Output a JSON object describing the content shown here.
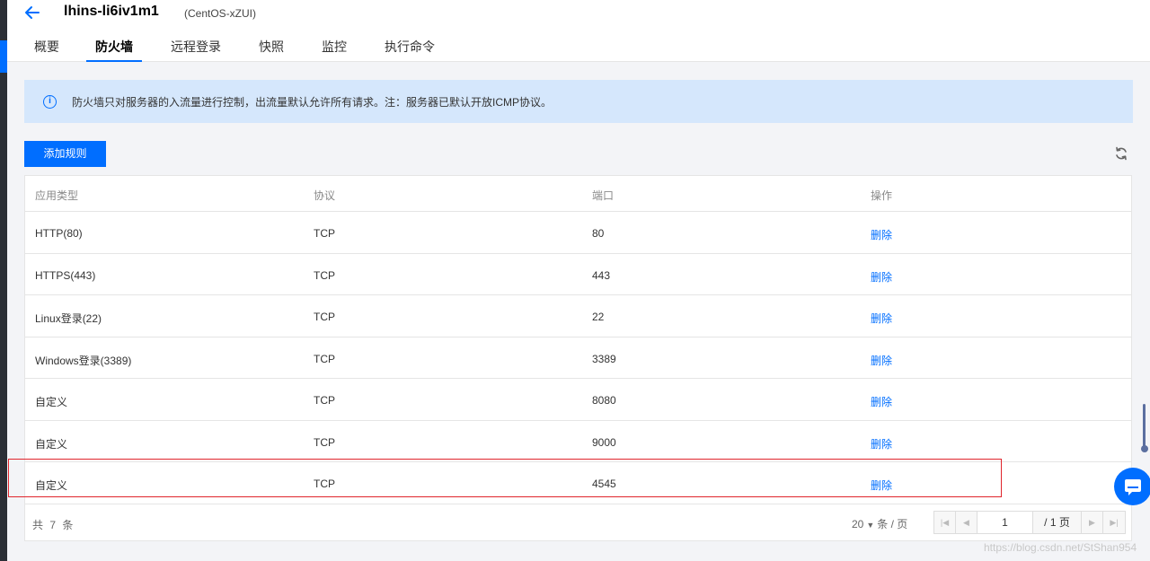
{
  "header": {
    "title": "lhins-li6iv1m1",
    "subtitle": "(CentOS-xZUI)",
    "tabs": [
      {
        "label": "概要"
      },
      {
        "label": "防火墙"
      },
      {
        "label": "远程登录"
      },
      {
        "label": "快照"
      },
      {
        "label": "监控"
      },
      {
        "label": "执行命令"
      }
    ]
  },
  "notice": {
    "text": "防火墙只对服务器的入流量进行控制，出流量默认允许所有请求。注：服务器已默认开放ICMP协议。"
  },
  "toolbar": {
    "add_label": "添加规则"
  },
  "table": {
    "columns": [
      "应用类型",
      "协议",
      "端口",
      "操作"
    ],
    "rows": [
      {
        "app": "HTTP(80)",
        "protocol": "TCP",
        "port": "80",
        "action": "删除"
      },
      {
        "app": "HTTPS(443)",
        "protocol": "TCP",
        "port": "443",
        "action": "删除"
      },
      {
        "app": "Linux登录(22)",
        "protocol": "TCP",
        "port": "22",
        "action": "删除"
      },
      {
        "app": "Windows登录(3389)",
        "protocol": "TCP",
        "port": "3389",
        "action": "删除"
      },
      {
        "app": "自定义",
        "protocol": "TCP",
        "port": "8080",
        "action": "删除"
      },
      {
        "app": "自定义",
        "protocol": "TCP",
        "port": "9000",
        "action": "删除"
      },
      {
        "app": "自定义",
        "protocol": "TCP",
        "port": "4545",
        "action": "删除"
      }
    ]
  },
  "pagination": {
    "total_text": "共 7 条",
    "page_size": "20",
    "page_size_unit": "条 / 页",
    "current_page": "1",
    "total_pages_text": "/ 1 页"
  },
  "watermark": "https://blog.csdn.net/StShan954",
  "colors": {
    "accent": "#006eff",
    "notice_bg": "#d5e7fc",
    "highlight": "#e0242c"
  }
}
